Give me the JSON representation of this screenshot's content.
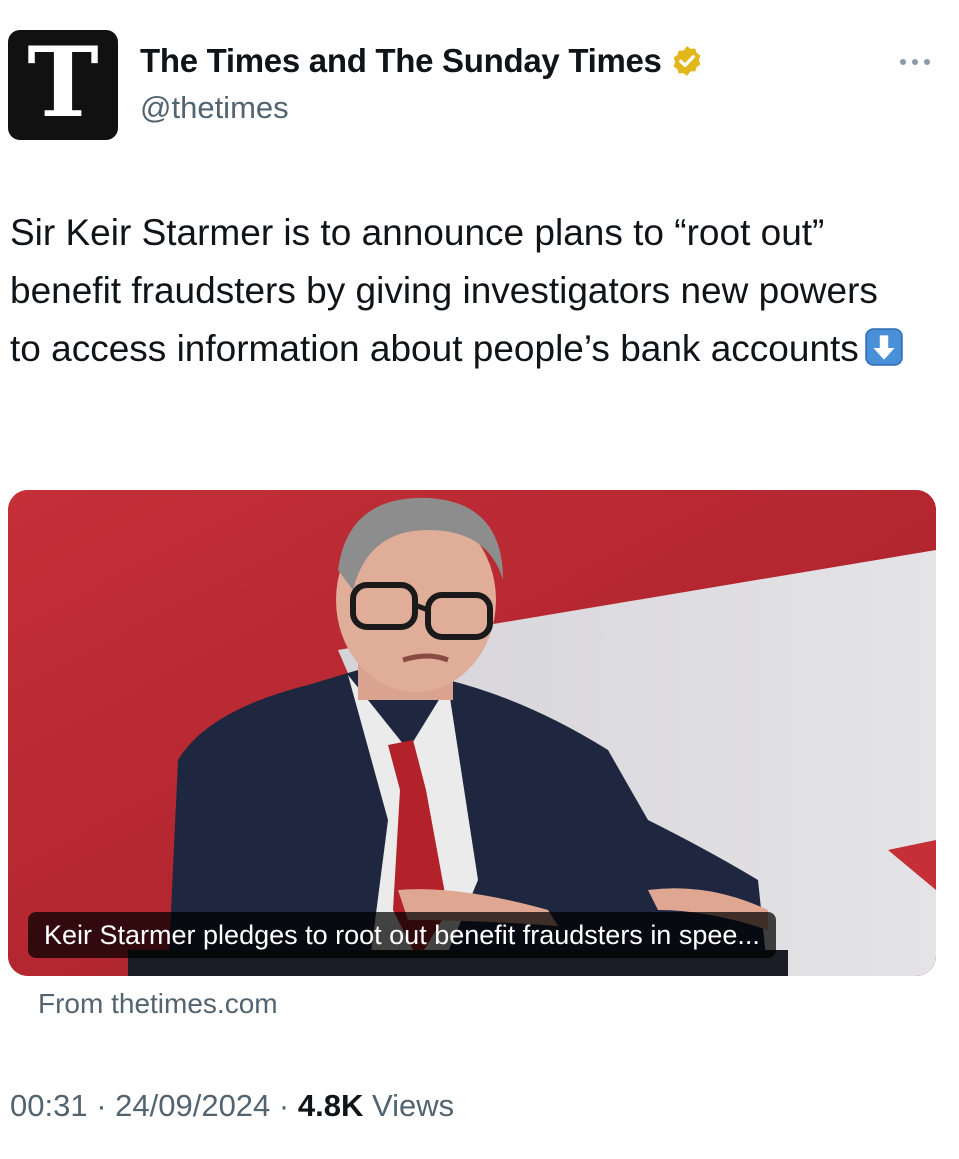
{
  "author": {
    "avatar_letter": "T",
    "display_name": "The Times and The Sunday Times",
    "handle": "@thetimes",
    "verified_icon": "gold-verified-badge-icon",
    "verified_color": "#e2b719"
  },
  "menu": {
    "icon": "more-options-icon"
  },
  "tweet": {
    "text": "Sir Keir Starmer is to announce plans to “root out” benefit fraudsters by giving investigators new powers to access information about people’s bank accounts",
    "emoji": "down-arrow-emoji"
  },
  "card": {
    "caption": "Keir Starmer pledges to root out benefit fraudsters in spee...",
    "source": "From thetimes.com",
    "background_color": "#b8262e"
  },
  "meta": {
    "time": "00:31",
    "sep1": " · ",
    "date": "24/09/2024",
    "sep2": " · ",
    "views_count": "4.8K",
    "views_label": " Views"
  }
}
